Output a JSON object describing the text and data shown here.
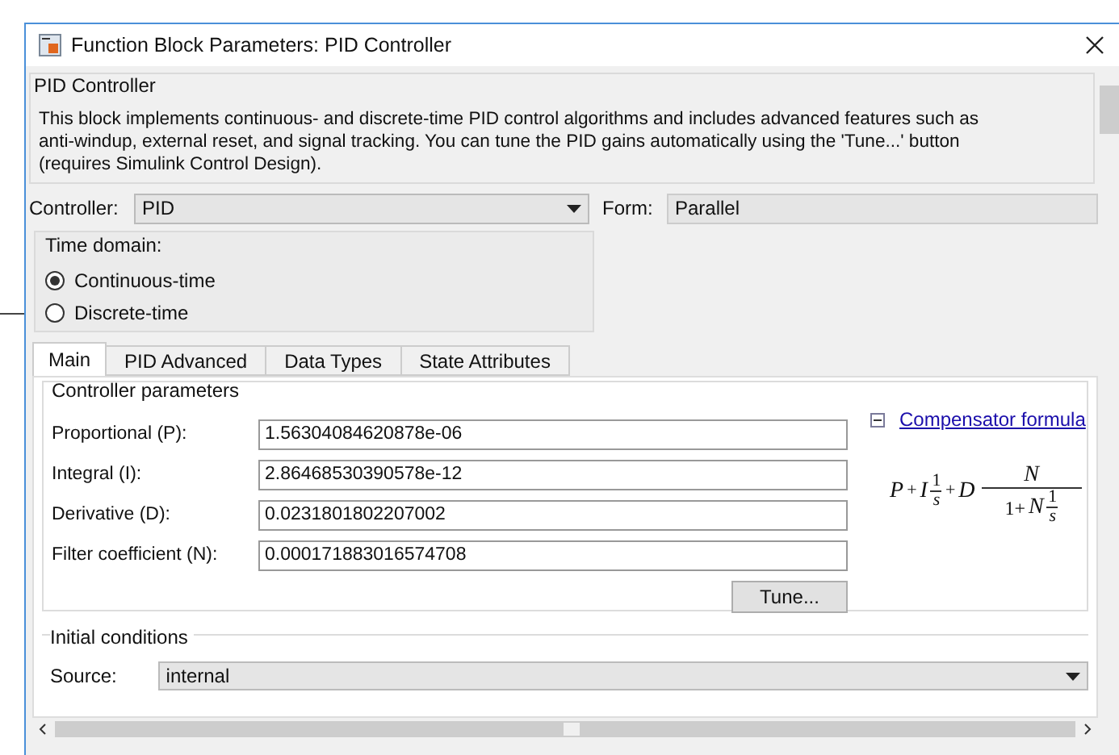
{
  "window": {
    "title": "Function Block Parameters: PID Controller"
  },
  "block_group": {
    "title": "PID Controller",
    "description": "This block implements continuous- and discrete-time PID control algorithms and includes advanced features such as anti-windup, external reset, and signal tracking. You can tune the PID gains automatically using the 'Tune...' button (requires Simulink Control Design)."
  },
  "controller": {
    "label": "Controller:",
    "value": "PID"
  },
  "form": {
    "label": "Form:",
    "value": "Parallel"
  },
  "time_domain": {
    "title": "Time domain:",
    "options": [
      {
        "label": "Continuous-time",
        "selected": true
      },
      {
        "label": "Discrete-time",
        "selected": false
      }
    ]
  },
  "tabs": [
    {
      "label": "Main",
      "selected": true
    },
    {
      "label": "PID Advanced",
      "selected": false
    },
    {
      "label": "Data Types",
      "selected": false
    },
    {
      "label": "State Attributes",
      "selected": false
    }
  ],
  "controller_parameters": {
    "title": "Controller parameters",
    "fields": [
      {
        "label": "Proportional (P):",
        "value": "1.56304084620878e-06"
      },
      {
        "label": "Integral (I):",
        "value": "2.86468530390578e-12"
      },
      {
        "label": "Derivative (D):",
        "value": "0.0231801802207002"
      },
      {
        "label": "Filter coefficient (N):",
        "value": "0.000171883016574708"
      }
    ],
    "tune_button": "Tune...",
    "formula_toggle": {
      "expanded": true
    },
    "formula_link": "Compensator formula",
    "formula": {
      "p": "P",
      "plus1": "+",
      "i": "I",
      "f1_num": "1",
      "f1_den": "s",
      "plus2": "+",
      "d": "D",
      "f2_num": "N",
      "f2_den_lead": "1+",
      "f2_den_n": "N",
      "f2_den_num": "1",
      "f2_den_den": "s"
    }
  },
  "initial_conditions": {
    "title": "Initial conditions",
    "source_label": "Source:",
    "source_value": "internal"
  }
}
